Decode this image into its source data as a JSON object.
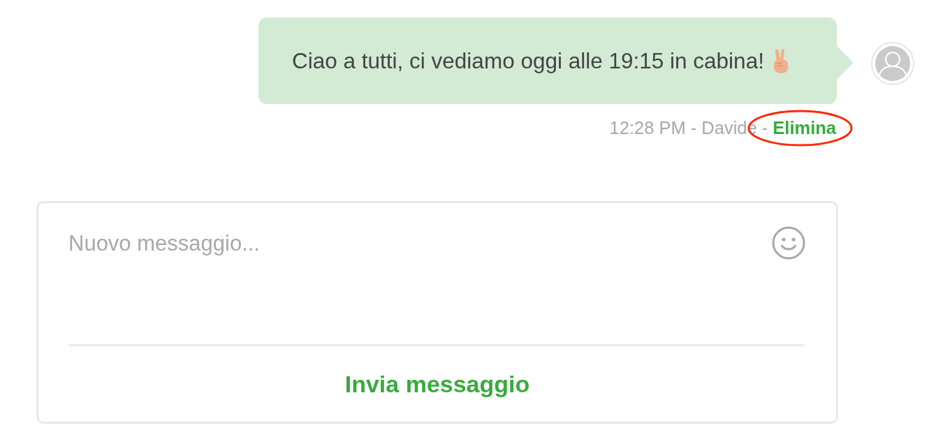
{
  "message": {
    "text": "Ciao a tutti, ci vediamo oggi alle 19:15 in cabina!",
    "info": "12:28 PM - Davide -",
    "delete_link": {
      "label": "Elimina",
      "circled": true
    }
  },
  "composer": {
    "placeholder": "Nuovo messaggio...",
    "send_button": "Invia messaggio"
  }
}
